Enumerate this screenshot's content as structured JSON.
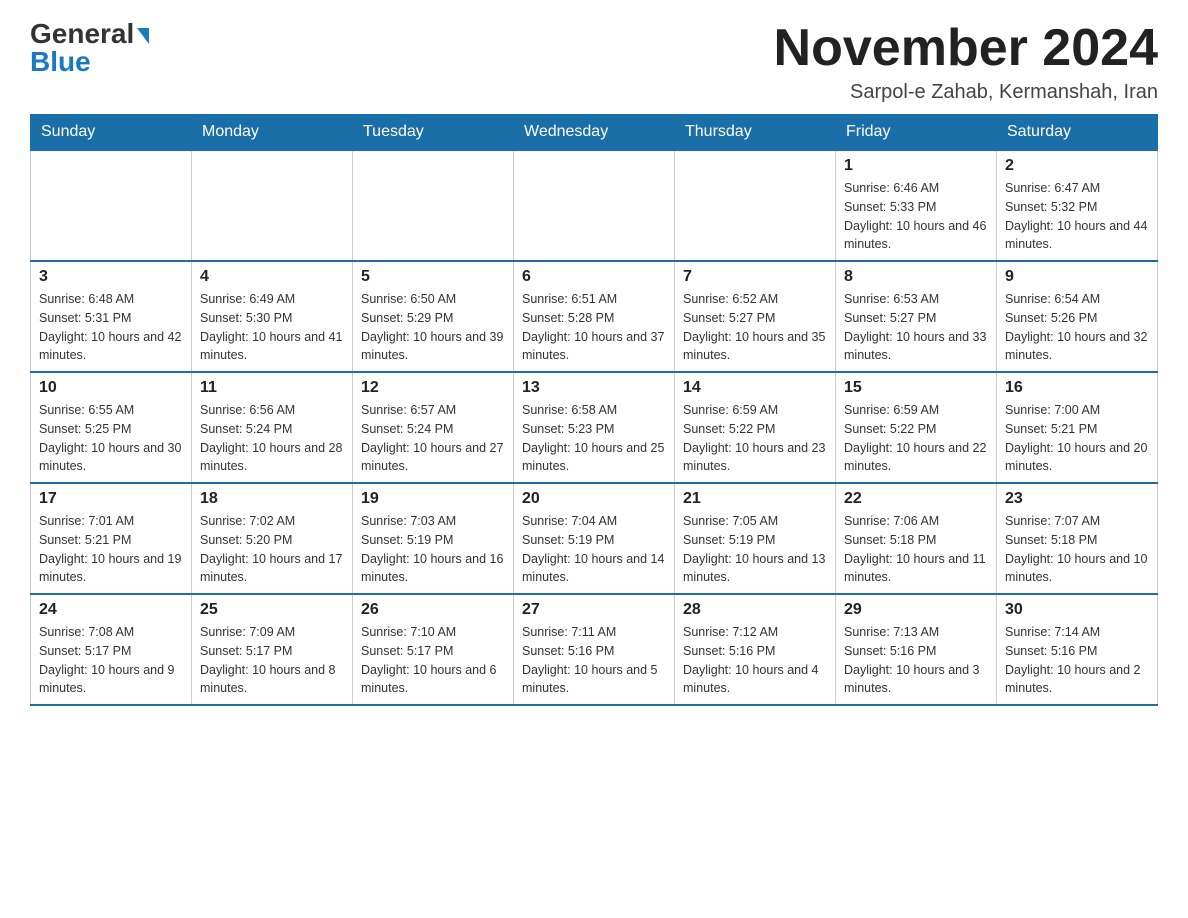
{
  "header": {
    "logo_general": "General",
    "logo_blue": "Blue",
    "month_title": "November 2024",
    "location": "Sarpol-e Zahab, Kermanshah, Iran"
  },
  "days_of_week": [
    "Sunday",
    "Monday",
    "Tuesday",
    "Wednesday",
    "Thursday",
    "Friday",
    "Saturday"
  ],
  "weeks": [
    [
      {
        "day": "",
        "sunrise": "",
        "sunset": "",
        "daylight": ""
      },
      {
        "day": "",
        "sunrise": "",
        "sunset": "",
        "daylight": ""
      },
      {
        "day": "",
        "sunrise": "",
        "sunset": "",
        "daylight": ""
      },
      {
        "day": "",
        "sunrise": "",
        "sunset": "",
        "daylight": ""
      },
      {
        "day": "",
        "sunrise": "",
        "sunset": "",
        "daylight": ""
      },
      {
        "day": "1",
        "sunrise": "Sunrise: 6:46 AM",
        "sunset": "Sunset: 5:33 PM",
        "daylight": "Daylight: 10 hours and 46 minutes."
      },
      {
        "day": "2",
        "sunrise": "Sunrise: 6:47 AM",
        "sunset": "Sunset: 5:32 PM",
        "daylight": "Daylight: 10 hours and 44 minutes."
      }
    ],
    [
      {
        "day": "3",
        "sunrise": "Sunrise: 6:48 AM",
        "sunset": "Sunset: 5:31 PM",
        "daylight": "Daylight: 10 hours and 42 minutes."
      },
      {
        "day": "4",
        "sunrise": "Sunrise: 6:49 AM",
        "sunset": "Sunset: 5:30 PM",
        "daylight": "Daylight: 10 hours and 41 minutes."
      },
      {
        "day": "5",
        "sunrise": "Sunrise: 6:50 AM",
        "sunset": "Sunset: 5:29 PM",
        "daylight": "Daylight: 10 hours and 39 minutes."
      },
      {
        "day": "6",
        "sunrise": "Sunrise: 6:51 AM",
        "sunset": "Sunset: 5:28 PM",
        "daylight": "Daylight: 10 hours and 37 minutes."
      },
      {
        "day": "7",
        "sunrise": "Sunrise: 6:52 AM",
        "sunset": "Sunset: 5:27 PM",
        "daylight": "Daylight: 10 hours and 35 minutes."
      },
      {
        "day": "8",
        "sunrise": "Sunrise: 6:53 AM",
        "sunset": "Sunset: 5:27 PM",
        "daylight": "Daylight: 10 hours and 33 minutes."
      },
      {
        "day": "9",
        "sunrise": "Sunrise: 6:54 AM",
        "sunset": "Sunset: 5:26 PM",
        "daylight": "Daylight: 10 hours and 32 minutes."
      }
    ],
    [
      {
        "day": "10",
        "sunrise": "Sunrise: 6:55 AM",
        "sunset": "Sunset: 5:25 PM",
        "daylight": "Daylight: 10 hours and 30 minutes."
      },
      {
        "day": "11",
        "sunrise": "Sunrise: 6:56 AM",
        "sunset": "Sunset: 5:24 PM",
        "daylight": "Daylight: 10 hours and 28 minutes."
      },
      {
        "day": "12",
        "sunrise": "Sunrise: 6:57 AM",
        "sunset": "Sunset: 5:24 PM",
        "daylight": "Daylight: 10 hours and 27 minutes."
      },
      {
        "day": "13",
        "sunrise": "Sunrise: 6:58 AM",
        "sunset": "Sunset: 5:23 PM",
        "daylight": "Daylight: 10 hours and 25 minutes."
      },
      {
        "day": "14",
        "sunrise": "Sunrise: 6:59 AM",
        "sunset": "Sunset: 5:22 PM",
        "daylight": "Daylight: 10 hours and 23 minutes."
      },
      {
        "day": "15",
        "sunrise": "Sunrise: 6:59 AM",
        "sunset": "Sunset: 5:22 PM",
        "daylight": "Daylight: 10 hours and 22 minutes."
      },
      {
        "day": "16",
        "sunrise": "Sunrise: 7:00 AM",
        "sunset": "Sunset: 5:21 PM",
        "daylight": "Daylight: 10 hours and 20 minutes."
      }
    ],
    [
      {
        "day": "17",
        "sunrise": "Sunrise: 7:01 AM",
        "sunset": "Sunset: 5:21 PM",
        "daylight": "Daylight: 10 hours and 19 minutes."
      },
      {
        "day": "18",
        "sunrise": "Sunrise: 7:02 AM",
        "sunset": "Sunset: 5:20 PM",
        "daylight": "Daylight: 10 hours and 17 minutes."
      },
      {
        "day": "19",
        "sunrise": "Sunrise: 7:03 AM",
        "sunset": "Sunset: 5:19 PM",
        "daylight": "Daylight: 10 hours and 16 minutes."
      },
      {
        "day": "20",
        "sunrise": "Sunrise: 7:04 AM",
        "sunset": "Sunset: 5:19 PM",
        "daylight": "Daylight: 10 hours and 14 minutes."
      },
      {
        "day": "21",
        "sunrise": "Sunrise: 7:05 AM",
        "sunset": "Sunset: 5:19 PM",
        "daylight": "Daylight: 10 hours and 13 minutes."
      },
      {
        "day": "22",
        "sunrise": "Sunrise: 7:06 AM",
        "sunset": "Sunset: 5:18 PM",
        "daylight": "Daylight: 10 hours and 11 minutes."
      },
      {
        "day": "23",
        "sunrise": "Sunrise: 7:07 AM",
        "sunset": "Sunset: 5:18 PM",
        "daylight": "Daylight: 10 hours and 10 minutes."
      }
    ],
    [
      {
        "day": "24",
        "sunrise": "Sunrise: 7:08 AM",
        "sunset": "Sunset: 5:17 PM",
        "daylight": "Daylight: 10 hours and 9 minutes."
      },
      {
        "day": "25",
        "sunrise": "Sunrise: 7:09 AM",
        "sunset": "Sunset: 5:17 PM",
        "daylight": "Daylight: 10 hours and 8 minutes."
      },
      {
        "day": "26",
        "sunrise": "Sunrise: 7:10 AM",
        "sunset": "Sunset: 5:17 PM",
        "daylight": "Daylight: 10 hours and 6 minutes."
      },
      {
        "day": "27",
        "sunrise": "Sunrise: 7:11 AM",
        "sunset": "Sunset: 5:16 PM",
        "daylight": "Daylight: 10 hours and 5 minutes."
      },
      {
        "day": "28",
        "sunrise": "Sunrise: 7:12 AM",
        "sunset": "Sunset: 5:16 PM",
        "daylight": "Daylight: 10 hours and 4 minutes."
      },
      {
        "day": "29",
        "sunrise": "Sunrise: 7:13 AM",
        "sunset": "Sunset: 5:16 PM",
        "daylight": "Daylight: 10 hours and 3 minutes."
      },
      {
        "day": "30",
        "sunrise": "Sunrise: 7:14 AM",
        "sunset": "Sunset: 5:16 PM",
        "daylight": "Daylight: 10 hours and 2 minutes."
      }
    ]
  ]
}
